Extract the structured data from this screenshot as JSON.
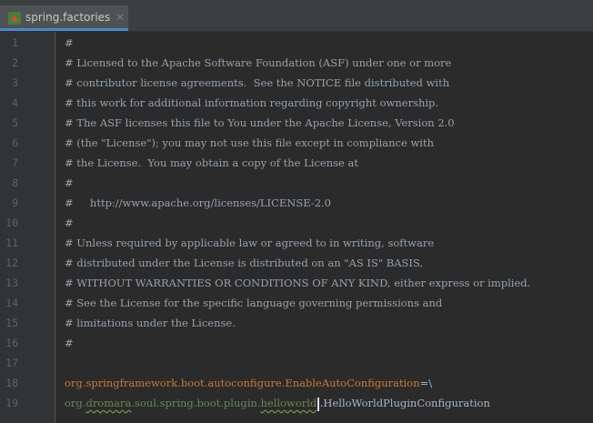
{
  "tab": {
    "label": "spring.factories",
    "close": "×"
  },
  "lines": [
    {
      "n": "1",
      "text": "#"
    },
    {
      "n": "2",
      "text": "# Licensed to the Apache Software Foundation (ASF) under one or more"
    },
    {
      "n": "3",
      "text": "# contributor license agreements.  See the NOTICE file distributed with"
    },
    {
      "n": "4",
      "text": "# this work for additional information regarding copyright ownership."
    },
    {
      "n": "5",
      "text": "# The ASF licenses this file to You under the Apache License, Version 2.0"
    },
    {
      "n": "6",
      "text": "# (the \"License\"); you may not use this file except in compliance with"
    },
    {
      "n": "7",
      "text": "# the License.  You may obtain a copy of the License at"
    },
    {
      "n": "8",
      "text": "#"
    },
    {
      "n": "9",
      "text": "#     http://www.apache.org/licenses/LICENSE-2.0"
    },
    {
      "n": "10",
      "text": "#"
    },
    {
      "n": "11",
      "text": "# Unless required by applicable law or agreed to in writing, software"
    },
    {
      "n": "12",
      "text": "# distributed under the License is distributed on an \"AS IS\" BASIS,"
    },
    {
      "n": "13",
      "text": "# WITHOUT WARRANTIES OR CONDITIONS OF ANY KIND, either express or implied."
    },
    {
      "n": "14",
      "text": "# See the License for the specific language governing permissions and"
    },
    {
      "n": "15",
      "text": "# limitations under the License."
    },
    {
      "n": "16",
      "text": "#"
    },
    {
      "n": "17",
      "text": ""
    },
    {
      "n": "18",
      "key": "org.springframework.boot.autoconfigure.EnableAutoConfiguration",
      "sep": "=\\"
    },
    {
      "n": "19",
      "pkg1": "org.",
      "pkg2": "dromara",
      "pkg3": ".soul.spring.boot.plugin.",
      "pkg4": "helloworld",
      "pkg5": ".HelloWorldPluginConfiguration"
    }
  ],
  "colors": {
    "background": "#2b2b2b",
    "gutter": "#313335",
    "keyword": "#cc7832",
    "string": "#6a8759",
    "text": "#a9b7c6"
  }
}
